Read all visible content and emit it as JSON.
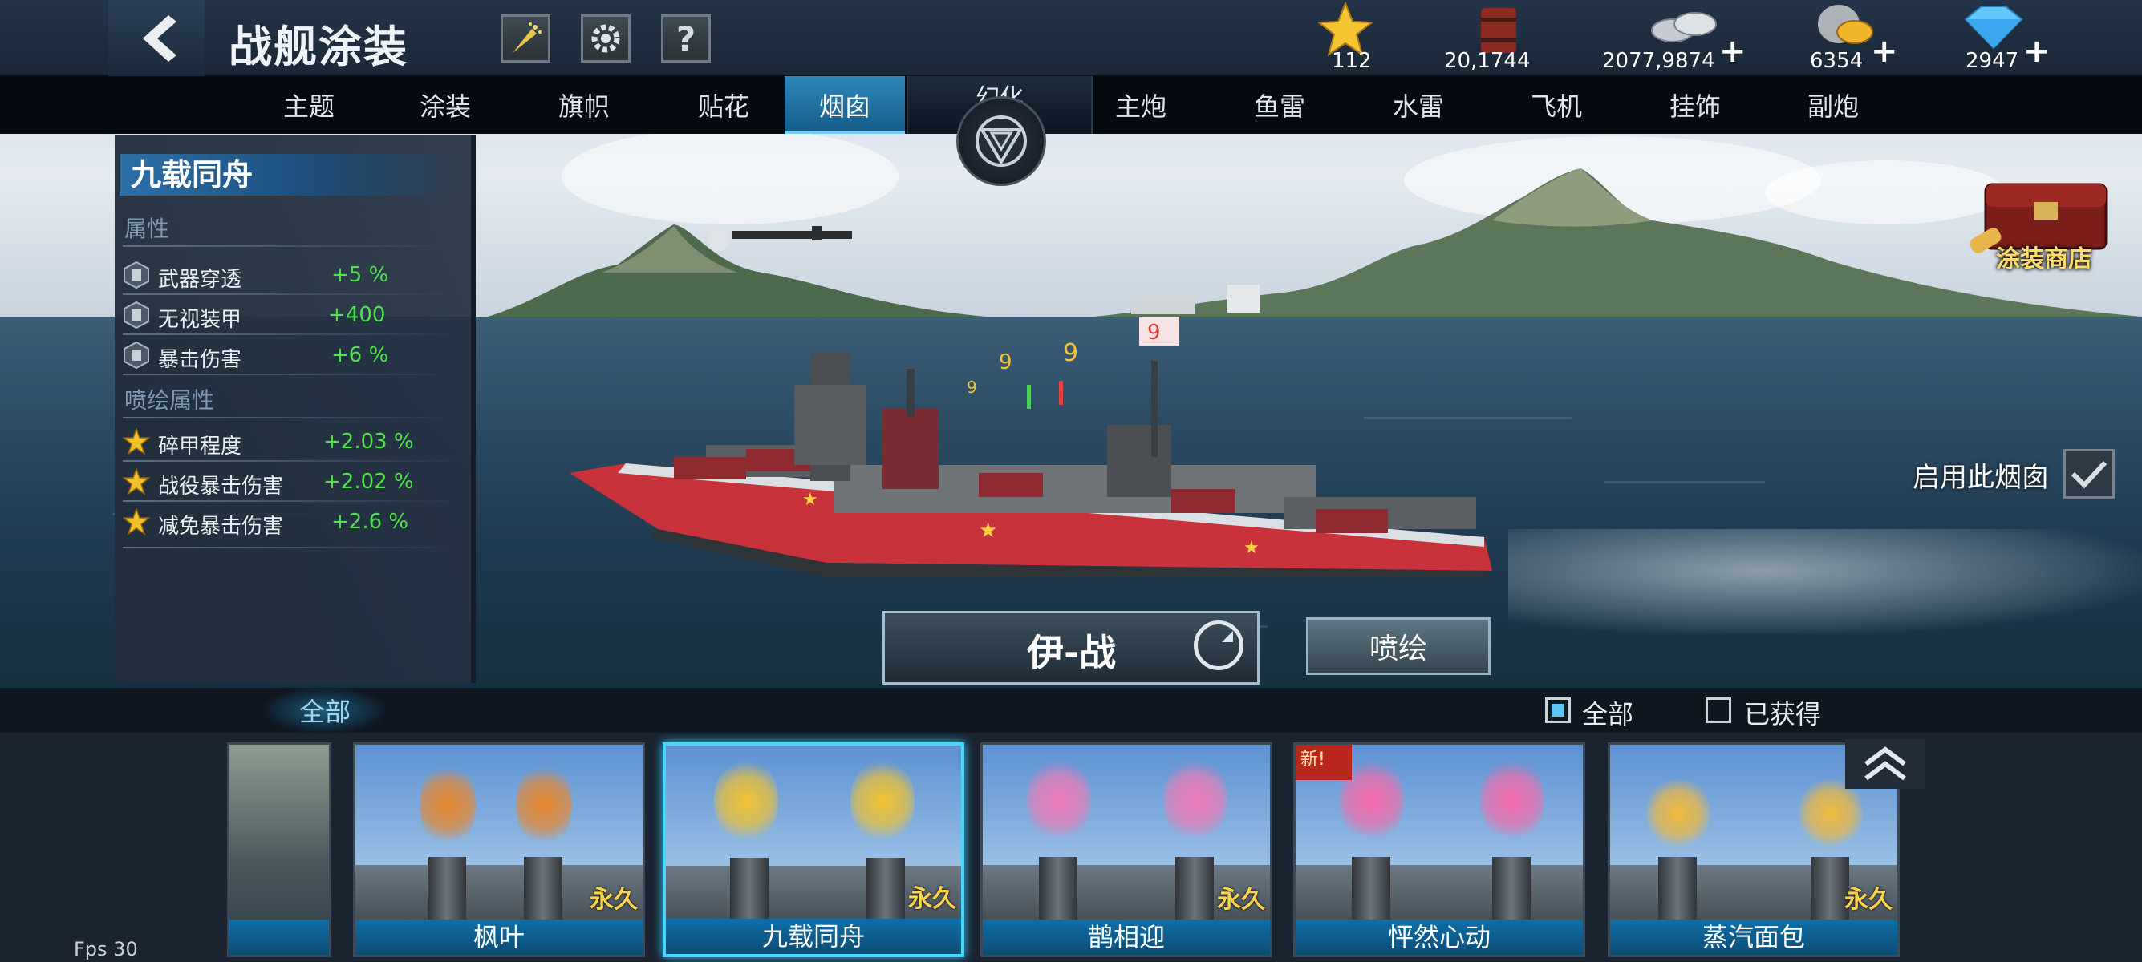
{
  "header": {
    "title": "战舰涂装",
    "tools": [
      "firework-icon",
      "gear-icon",
      "help-icon"
    ],
    "help_label": "?"
  },
  "resources": [
    {
      "icon": "star-icon",
      "value": "112",
      "plus": false
    },
    {
      "icon": "fuel-barrel-icon",
      "value": "20,1744",
      "plus": false
    },
    {
      "icon": "silver-coin-icon",
      "value": "2077,9874",
      "plus": true
    },
    {
      "icon": "gold-coin-icon",
      "value": "6354",
      "plus": true
    },
    {
      "icon": "diamond-icon",
      "value": "2947",
      "plus": true
    }
  ],
  "tabs_left": [
    "主题",
    "涂装",
    "旗帜",
    "贴花",
    "烟囱"
  ],
  "tabs_right": [
    "主炮",
    "鱼雷",
    "水雷",
    "飞机",
    "挂饰",
    "副炮"
  ],
  "active_tab": "烟囱",
  "huanhua_label": "幻化",
  "panel": {
    "title": "九载同舟",
    "attr_section": "属性",
    "attrs": [
      {
        "name": "武器穿透",
        "value": "+5 %"
      },
      {
        "name": "无视装甲",
        "value": "+400"
      },
      {
        "name": "暴击伤害",
        "value": "+6 %"
      }
    ],
    "spray_section": "喷绘属性",
    "spray_attrs": [
      {
        "name": "碎甲程度",
        "value": "+2.03 %"
      },
      {
        "name": "战役暴击伤害",
        "value": "+2.02 %"
      },
      {
        "name": "减免暴击伤害",
        "value": "+2.6 %"
      }
    ]
  },
  "shop_label": "涂装商店",
  "enable_label": "启用此烟囱",
  "ship_name": "伊-战",
  "spray_button": "喷绘",
  "filter": {
    "tab_all": "全部",
    "options": [
      {
        "label": "全部",
        "checked": true
      },
      {
        "label": "已获得",
        "checked": false
      }
    ]
  },
  "cards": [
    {
      "name": "枫叶",
      "tag": "永久",
      "selected": false,
      "new": false,
      "puff": "#e7852a"
    },
    {
      "name": "九载同舟",
      "tag": "永久",
      "selected": true,
      "new": false,
      "puff": "#f2c230"
    },
    {
      "name": "鹊相迎",
      "tag": "永久",
      "selected": false,
      "new": false,
      "puff": "#f07ab6"
    },
    {
      "name": "怦然心动",
      "tag": "",
      "selected": false,
      "new": true,
      "puff": "#f56aa8"
    },
    {
      "name": "蒸汽面包",
      "tag": "永久",
      "selected": false,
      "new": false,
      "puff": "#f3b93a"
    }
  ],
  "new_badge": "新!",
  "fps": "Fps 30",
  "colors": {
    "accent": "#48d6ff",
    "positive": "#4fe04a",
    "gold": "#ffd34a"
  }
}
